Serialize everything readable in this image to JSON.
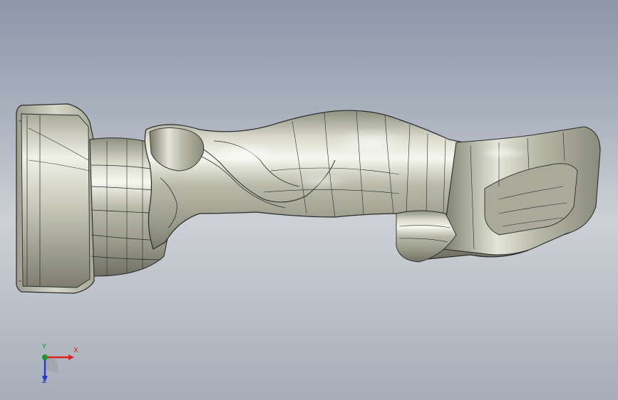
{
  "view": {
    "model_name": "",
    "background": [
      "#8d97a8",
      "#cdd1d6",
      "#a6adb8"
    ],
    "model_color": "#c9cab8"
  },
  "triad": {
    "x_label": "X",
    "y_label": "Y",
    "z_label": "Z",
    "colors": {
      "x": "#e01f1f",
      "y": "#1c9b2a",
      "z": "#2838c8"
    }
  }
}
